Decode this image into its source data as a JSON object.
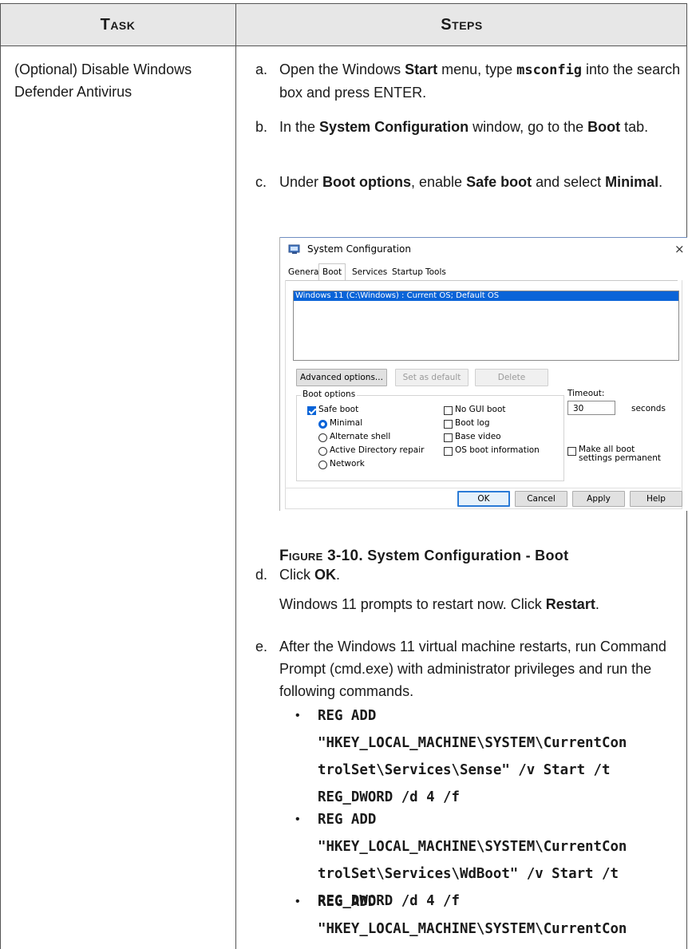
{
  "header": {
    "task": "Task",
    "steps": "Steps"
  },
  "task": {
    "text": "(Optional) Disable Windows Defender Antivirus"
  },
  "steps": {
    "a": {
      "label": "a.",
      "t1": "Open the Windows ",
      "b1": "Start",
      "t2": " menu, type ",
      "code": "msconfig",
      "t3": " into the search box and press ENTER."
    },
    "b": {
      "label": "b.",
      "t1": "In the ",
      "b1": "System Configuration",
      "t2": " window, go to the ",
      "b2": "Boot",
      "t3": " tab."
    },
    "c": {
      "label": "c.",
      "t1": "Under ",
      "b1": "Boot options",
      "t2": ", enable ",
      "b2": "Safe boot",
      "t3": " and select ",
      "b3": "Minimal",
      "t4": "."
    },
    "d": {
      "label": "d.",
      "t1": "Click ",
      "b1": "OK",
      "t2": "."
    },
    "d_note": {
      "t1": "Windows 11 prompts to restart now. Click ",
      "b1": "Restart",
      "t2": "."
    },
    "e": {
      "label": "e.",
      "text": "After the Windows 11 virtual machine restarts, run Command Prompt (cmd.exe) with administrator privileges and run the following commands."
    }
  },
  "commands": [
    {
      "l1": "REG ADD",
      "l2": "\"HKEY_LOCAL_MACHINE\\SYSTEM\\CurrentCon",
      "l3": "trolSet\\Services\\Sense\" /v Start /t",
      "l4": "REG_DWORD /d 4 /f"
    },
    {
      "l1": "REG ADD",
      "l2": "\"HKEY_LOCAL_MACHINE\\SYSTEM\\CurrentCon",
      "l3": "trolSet\\Services\\WdBoot\" /v Start /t",
      "l4": "REG_DWORD /d 4 /f"
    },
    {
      "l1": "REG ADD",
      "l2": "\"HKEY_LOCAL_MACHINE\\SYSTEM\\CurrentCon"
    }
  ],
  "caption": {
    "fig": "Figure 3-10.",
    "text": " System Configuration - Boot"
  },
  "dialog": {
    "title": "System Configuration",
    "close": "×",
    "tabs": [
      "General",
      "Boot",
      "Services",
      "Startup",
      "Tools"
    ],
    "os_entry": "Windows 11 (C:\\Windows) : Current OS; Default OS",
    "buttons": {
      "advanced": "Advanced options...",
      "set_default": "Set as default",
      "delete": "Delete"
    },
    "boot_options_label": "Boot options",
    "safe_boot": "Safe boot",
    "radios": [
      "Minimal",
      "Alternate shell",
      "Active Directory repair",
      "Network"
    ],
    "checks": [
      "No GUI boot",
      "Boot log",
      "Base video",
      "OS boot information"
    ],
    "timeout_label": "Timeout:",
    "timeout_value": "30",
    "seconds": "seconds",
    "make_permanent": "Make all boot settings permanent",
    "footer": {
      "ok": "OK",
      "cancel": "Cancel",
      "apply": "Apply",
      "help": "Help"
    },
    "icon": "computer-icon"
  }
}
